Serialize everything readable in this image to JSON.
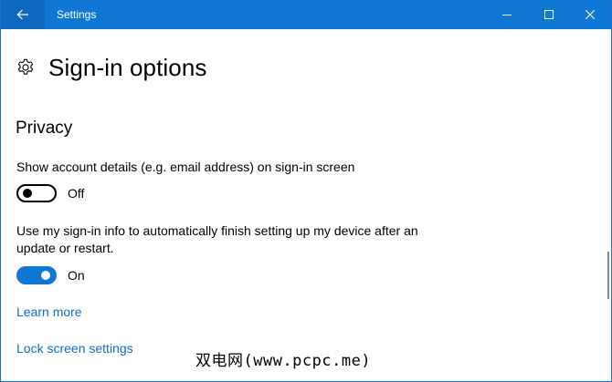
{
  "window": {
    "title": "Settings",
    "accent_color": "#0f78d4",
    "controls": [
      "minimize-icon",
      "maximize-icon",
      "close-icon"
    ]
  },
  "header": {
    "icon": "gear-icon",
    "title": "Sign-in options"
  },
  "privacy": {
    "heading": "Privacy",
    "settings": [
      {
        "label": "Show account details (e.g. email address) on sign-in screen",
        "state": "Off",
        "enabled": false
      },
      {
        "label": "Use my sign-in info to automatically finish setting up my device after an update or restart.",
        "state": "On",
        "enabled": true
      }
    ]
  },
  "links": {
    "learn_more": "Learn more",
    "lock_screen": "Lock screen settings",
    "link_color": "#0f6fc6"
  },
  "watermark": "双电网(www.pcpc.me)"
}
